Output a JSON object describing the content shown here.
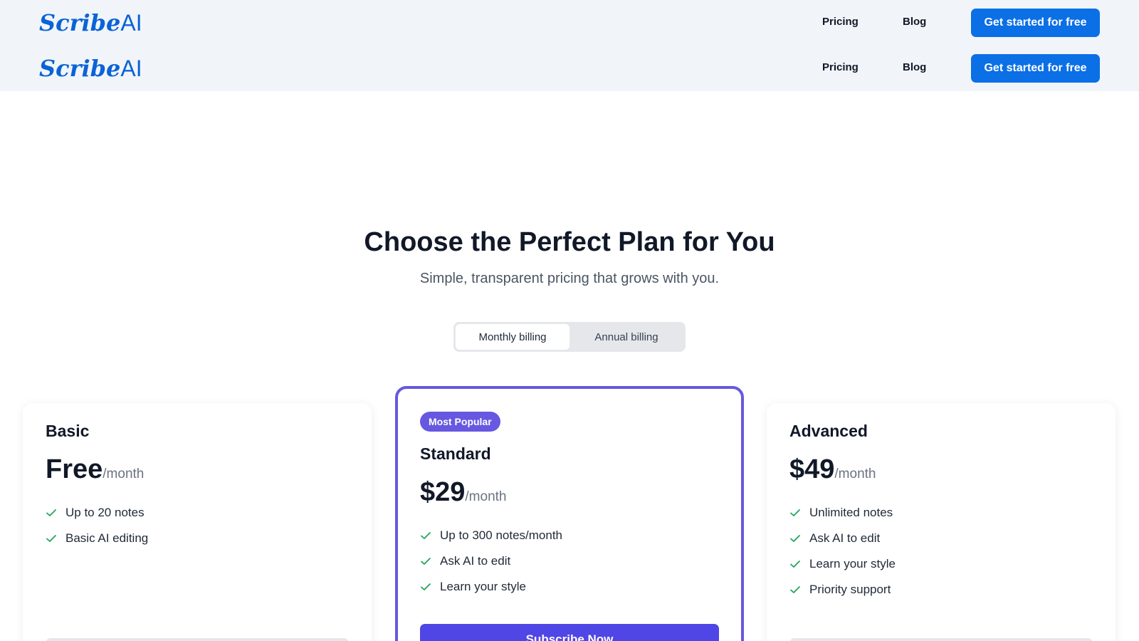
{
  "navbar": {
    "logo_script": "Scribe",
    "logo_suffix": "AI",
    "links": [
      "Pricing",
      "Blog"
    ],
    "cta_label": "Get started for free"
  },
  "hero": {
    "title": "Choose the Perfect Plan for You",
    "subtitle": "Simple, transparent pricing that grows with you."
  },
  "billing": {
    "options": [
      "Monthly billing",
      "Annual billing"
    ],
    "selected": "Monthly billing"
  },
  "plans": [
    {
      "name": "Basic",
      "price": "Free",
      "period": "/month",
      "features": [
        "Up to 20 notes",
        "Basic AI editing"
      ]
    },
    {
      "name": "Standard",
      "badge": "Most Popular",
      "price": "$29",
      "period": "/month",
      "features": [
        "Up to 300 notes/month",
        "Ask AI to edit",
        "Learn your style"
      ],
      "button_label": "Subscribe Now"
    },
    {
      "name": "Advanced",
      "price": "$49",
      "period": "/month",
      "features": [
        "Unlimited notes",
        "Ask AI to edit",
        "Learn your style",
        "Priority support"
      ]
    }
  ],
  "colors": {
    "header_bg": "#f1f5f9",
    "brand_blue": "#0b6fe6",
    "highlight_purple": "#6658e0",
    "check_green": "#22a559"
  },
  "icons": {
    "feature_check": "check-icon"
  }
}
